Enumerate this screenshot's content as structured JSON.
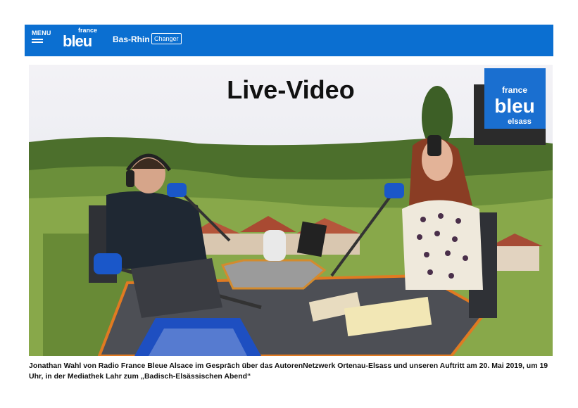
{
  "header": {
    "menu_label": "MENU",
    "logo_small": "france",
    "logo_main": "bleu",
    "region": "Bas-Rhin",
    "change_label": "Changer"
  },
  "video": {
    "title": "Live-Video",
    "studio_logo": {
      "top": "france",
      "main": "bleu",
      "bottom": "elsass"
    }
  },
  "caption": "Jonathan Wahl von Radio France Bleue Alsace im Gespräch über das AutorenNetzwerk Ortenau-Elsass und unseren Auftritt am 20. Mai 2019, um 19 Uhr, in der Mediathek Lahr zum „Badisch-Elsässischen Abend“",
  "colors": {
    "header_bg": "#0b6fd1",
    "logo_blue": "#1a6fd0"
  }
}
